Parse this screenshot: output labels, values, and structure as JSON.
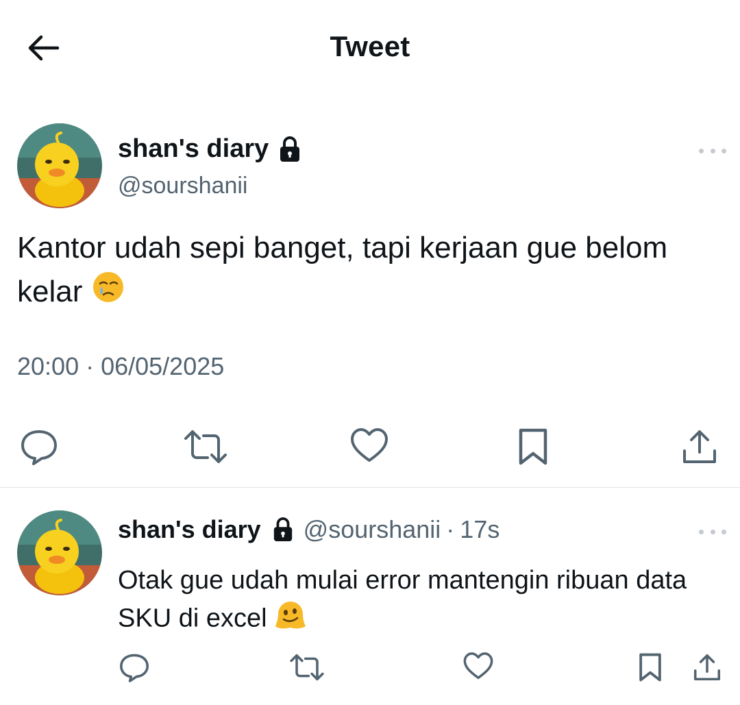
{
  "header": {
    "title": "Tweet"
  },
  "main_tweet": {
    "author_name": "shan's diary",
    "handle": "@sourshanii",
    "text": "Kantor udah sepi banget, tapi kerjaan gue belom kelar",
    "text_emoji": "face-holding-back-tears-icon",
    "timestamp": "20:00 · 06/05/2025",
    "actions": [
      "reply",
      "retweet",
      "like",
      "bookmark",
      "share"
    ]
  },
  "reply_tweet": {
    "author_name": "shan's diary",
    "handle": "@sourshanii",
    "separator": "·",
    "time": "17s",
    "text": "Otak gue udah mulai error mantengin ribuan data SKU di excel",
    "text_emoji": "melting-face-icon",
    "actions": [
      "reply",
      "retweet",
      "like",
      "bookmark",
      "share"
    ]
  },
  "colors": {
    "text": "#0f1419",
    "secondary": "#536471",
    "icon": "#536471",
    "divider": "#e1e6ea",
    "emoji": "#f7b928"
  }
}
